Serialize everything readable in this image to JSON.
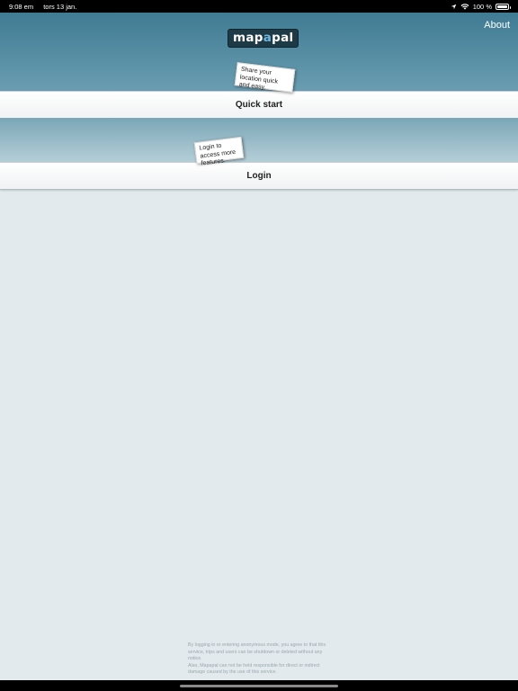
{
  "status_bar": {
    "time": "9:08 em",
    "date": "tors 13 jan.",
    "battery_text": "100 %",
    "battery_level": 1.0
  },
  "header": {
    "logo_part1": "map",
    "logo_part2": "a",
    "logo_part3": "pal",
    "about_label": "About"
  },
  "quick_start": {
    "note": "Share your location quick and easy.",
    "button_label": "Quick start"
  },
  "login": {
    "note": "Login to access more features.",
    "button_label": "Login"
  },
  "disclaimer": {
    "line1": "By logging in or entering anonymous mode, you agree to that this service, trips and users can be shutdown or deleted without any notice.",
    "line2": "Also, Mapapal can not be held responsible for direct or indirect damage caused by the use of this service."
  },
  "colors": {
    "header_top": "#3f7b93",
    "header_bottom": "#6a9db1",
    "page_background": "#e2eaed"
  }
}
